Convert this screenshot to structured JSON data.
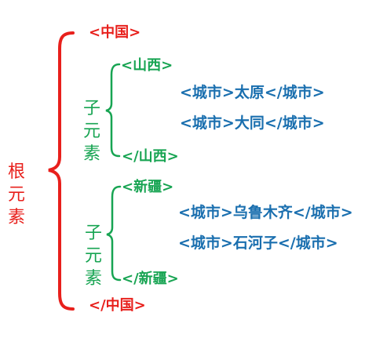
{
  "colors": {
    "root": "#e8201c",
    "child": "#17a452",
    "city": "#1a6faf"
  },
  "root": {
    "label": "根元素",
    "open_tag": "<中国>",
    "close_tag": "</中国>"
  },
  "children": [
    {
      "label": "子元素",
      "open_tag": "<山西>",
      "close_tag": "</山西>",
      "cities": [
        "<城市>太原</城市>",
        "<城市>大同</城市>"
      ]
    },
    {
      "label": "子元素",
      "open_tag": "<新疆>",
      "close_tag": "</新疆>",
      "cities": [
        "<城市>乌鲁木齐</城市>",
        "<城市>石河子</城市>"
      ]
    }
  ]
}
